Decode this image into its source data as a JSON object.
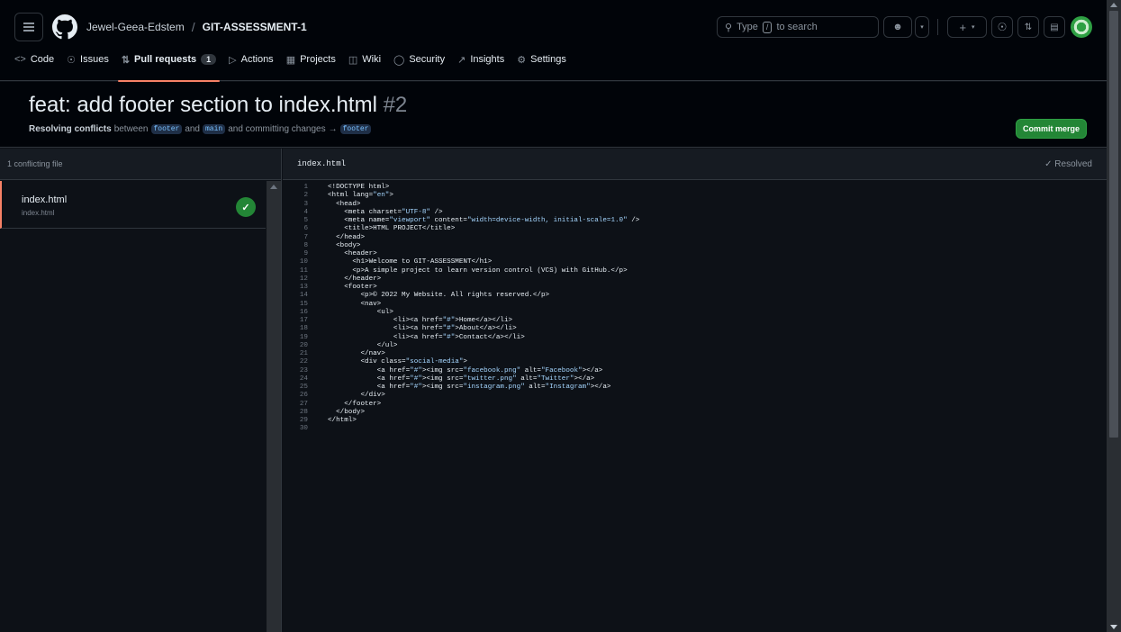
{
  "header": {
    "owner": "Jewel-Geea-Edstem",
    "separator": "/",
    "repo": "GIT-ASSESSMENT-1",
    "search_placeholder": "Type",
    "search_key": "/",
    "search_suffix": "to search"
  },
  "tabs": [
    {
      "label": "Code",
      "icon": "code-icon"
    },
    {
      "label": "Issues",
      "icon": "issue-icon"
    },
    {
      "label": "Pull requests",
      "icon": "pull-request-icon",
      "count": "1",
      "active": true
    },
    {
      "label": "Actions",
      "icon": "play-icon"
    },
    {
      "label": "Projects",
      "icon": "table-icon"
    },
    {
      "label": "Wiki",
      "icon": "book-icon"
    },
    {
      "label": "Security",
      "icon": "shield-icon"
    },
    {
      "label": "Insights",
      "icon": "graph-icon"
    },
    {
      "label": "Settings",
      "icon": "gear-icon"
    }
  ],
  "pr": {
    "title": "feat: add footer section to index.html",
    "number": "#2",
    "sub_prefix": "Resolving conflicts",
    "sub_between": "between",
    "base_branch": "footer",
    "sub_and": "and",
    "head_branch": "main",
    "sub_committing": "and committing changes",
    "arrow": "→",
    "target_branch": "footer",
    "commit_button": "Commit merge"
  },
  "sidebar": {
    "header": "1 conflicting file",
    "file_name": "index.html",
    "file_path": "index.html"
  },
  "editor": {
    "file": "index.html",
    "status": "✓ Resolved",
    "lines": [
      "<!DOCTYPE html>",
      "<html lang=\"en\">",
      "  <head>",
      "    <meta charset=\"UTF-8\" />",
      "    <meta name=\"viewport\" content=\"width=device-width, initial-scale=1.0\" />",
      "    <title>HTML PROJECT</title>",
      "  </head>",
      "  <body>",
      "    <header>",
      "      <h1>Welcome to GIT-ASSESSMENT</h1>",
      "      <p>A simple project to learn version control (VCS) with GitHub.</p>",
      "    </header>",
      "    <footer>",
      "        <p>© 2022 My Website. All rights reserved.</p>",
      "        <nav>",
      "            <ul>",
      "                <li><a href=\"#\">Home</a></li>",
      "                <li><a href=\"#\">About</a></li>",
      "                <li><a href=\"#\">Contact</a></li>",
      "            </ul>",
      "        </nav>",
      "        <div class=\"social-media\">",
      "            <a href=\"#\"><img src=\"facebook.png\" alt=\"Facebook\"></a>",
      "            <a href=\"#\"><img src=\"twitter.png\" alt=\"Twitter\"></a>",
      "            <a href=\"#\"><img src=\"instagram.png\" alt=\"Instagram\"></a>",
      "        </div>",
      "    </footer>",
      "  </body>",
      "</html>",
      ""
    ]
  },
  "colors": {
    "accent_underline": "#f78166",
    "success": "#238636",
    "string": "#a5d6ff"
  }
}
